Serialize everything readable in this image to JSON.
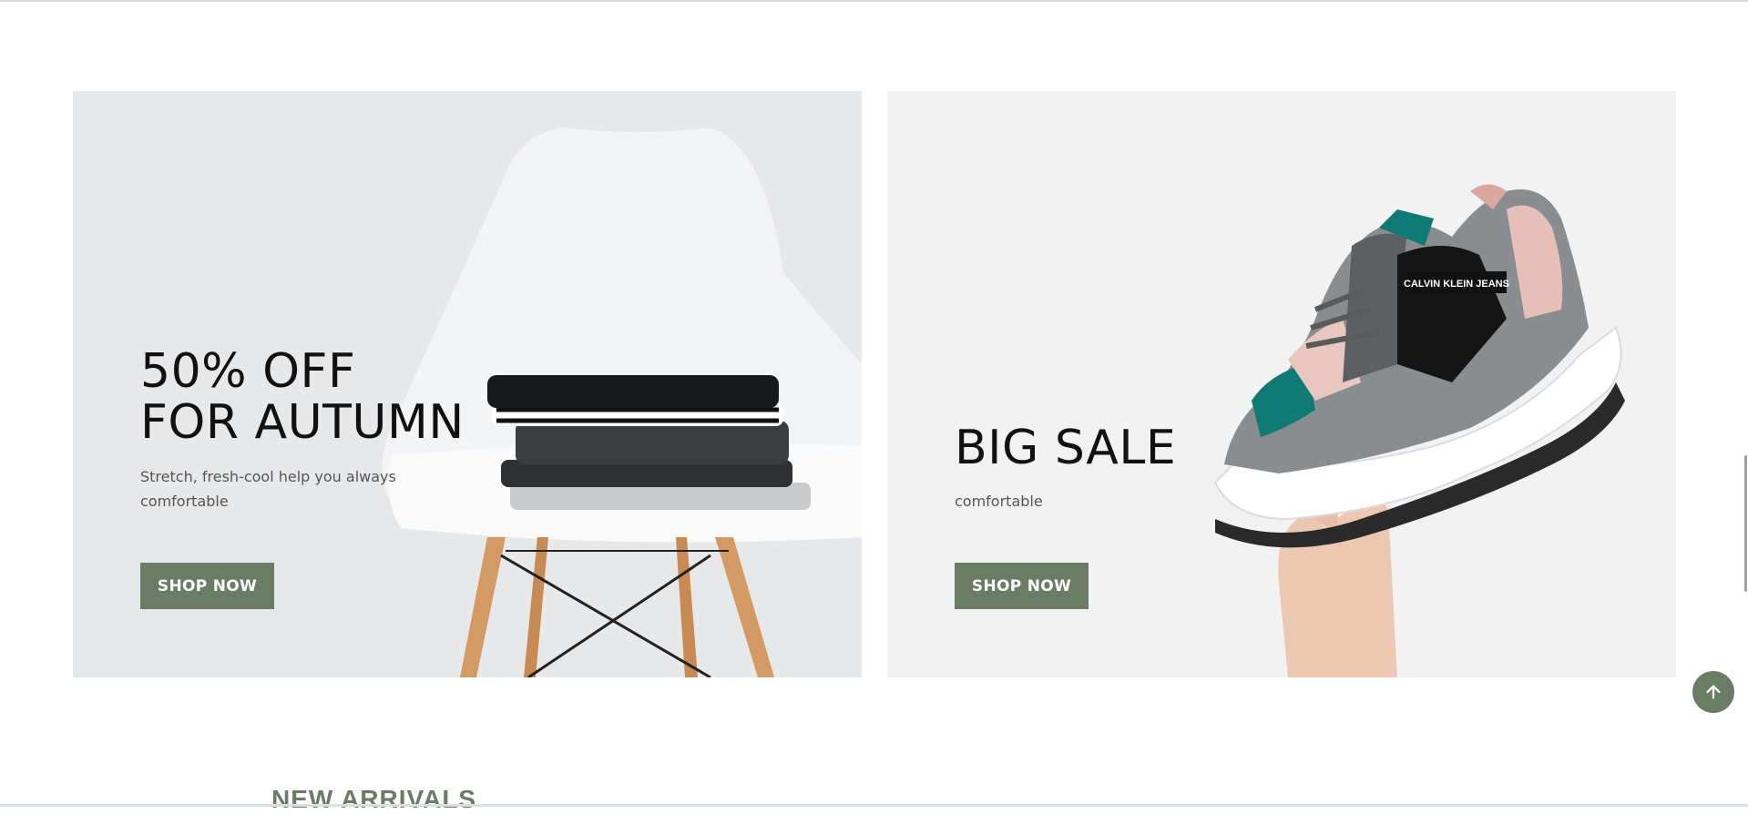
{
  "banners": [
    {
      "title_lines": [
        "50% OFF",
        "FOR AUTUMN"
      ],
      "description": "Stretch, fresh-cool help you always comfortable",
      "button_label": "SHOP NOW"
    },
    {
      "title_lines": [
        "BIG SALE"
      ],
      "description": "comfortable",
      "button_label": "SHOP NOW",
      "product_brand_text": "CALVIN KLEIN JEANS"
    }
  ],
  "section": {
    "heading": "NEW ARRIVALS"
  },
  "icons": {
    "scroll_top": "arrow-up-icon"
  },
  "colors": {
    "accent": "#6b7c65",
    "title": "#111111",
    "body_text": "#555555"
  }
}
